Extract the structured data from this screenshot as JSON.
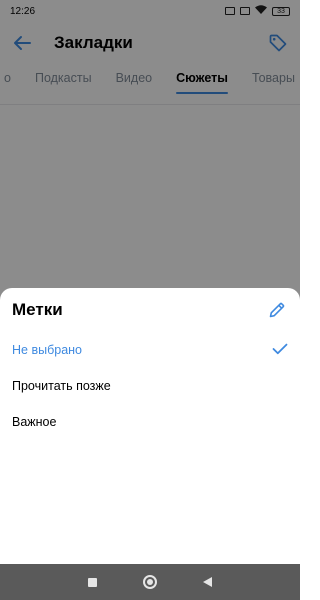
{
  "status_bar": {
    "time": "12:26",
    "battery": "33"
  },
  "header": {
    "title": "Закладки",
    "back_icon": "arrow-left-icon",
    "tag_icon": "tag-icon"
  },
  "tabs": [
    {
      "label": "Подкасты",
      "active": false
    },
    {
      "label": "Видео",
      "active": false
    },
    {
      "label": "Сюжеты",
      "active": true
    },
    {
      "label": "Товары",
      "active": false
    }
  ],
  "sheet": {
    "title": "Метки",
    "edit_icon": "pencil-icon",
    "options": [
      {
        "label": "Не выбрано",
        "selected": true
      },
      {
        "label": "Прочитать позже",
        "selected": false
      },
      {
        "label": "Важное",
        "selected": false
      }
    ]
  },
  "colors": {
    "accent": "#3f8ae0",
    "muted_text": "#818c99",
    "overlay": "rgba(0,0,0,0.45)",
    "nav_bar": "#5a5a5a"
  },
  "nav": {
    "recents_icon": "square-icon",
    "home_icon": "circle-icon",
    "back_icon": "triangle-back-icon"
  }
}
